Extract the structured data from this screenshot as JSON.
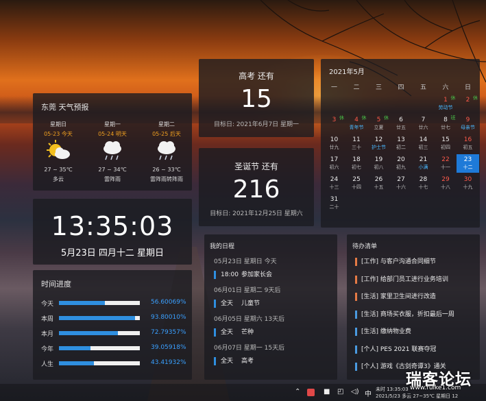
{
  "weather": {
    "title": "东莞 天气预报",
    "days": [
      {
        "name": "星期日",
        "date": "05-23 今天",
        "icon": "partly-cloudy-icon",
        "temp": "27 ~ 35℃",
        "desc": "多云"
      },
      {
        "name": "星期一",
        "date": "05-24 明天",
        "icon": "thunder-rain-icon",
        "temp": "27 ~ 34℃",
        "desc": "雷阵雨"
      },
      {
        "name": "星期二",
        "date": "05-25 后天",
        "icon": "thunder-rain-icon",
        "temp": "26 ~ 33℃",
        "desc": "雷阵雨转阵雨"
      }
    ]
  },
  "clock": {
    "time": "13:35:03",
    "date": "5月23日 四月十二 星期日"
  },
  "progress": {
    "title": "时间进度",
    "rows": [
      {
        "label": "今天",
        "value": "56.60069%",
        "fraction": 0.566
      },
      {
        "label": "本周",
        "value": "93.80010%",
        "fraction": 0.938
      },
      {
        "label": "本月",
        "value": "72.79357%",
        "fraction": 0.728
      },
      {
        "label": "今年",
        "value": "39.05918%",
        "fraction": 0.391
      },
      {
        "label": "人生",
        "value": "43.41932%",
        "fraction": 0.434
      }
    ]
  },
  "countdowns": [
    {
      "label": "高考 还有",
      "days": "15",
      "target": "目标日: 2021年6月7日 星期一"
    },
    {
      "label": "圣诞节 还有",
      "days": "216",
      "target": "目标日: 2021年12月25日 星期六"
    }
  ],
  "calendar": {
    "title": "2021年5月",
    "weekdays": [
      "一",
      "二",
      "三",
      "四",
      "五",
      "六",
      "日"
    ],
    "weeks": [
      [
        null,
        null,
        null,
        null,
        null,
        {
          "n": "1",
          "l": "劳动节",
          "red": true,
          "fest": true,
          "badge": "休"
        },
        {
          "n": "2",
          "l": "",
          "red": true,
          "badge": "休"
        }
      ],
      [
        {
          "n": "3",
          "l": "",
          "red": true,
          "badge": "休"
        },
        {
          "n": "4",
          "l": "青年节",
          "red": true,
          "fest": true,
          "badge": "休"
        },
        {
          "n": "5",
          "l": "立夏",
          "red": true,
          "badge": "休"
        },
        {
          "n": "6",
          "l": "廿五"
        },
        {
          "n": "7",
          "l": "廿六"
        },
        {
          "n": "8",
          "l": "廿七",
          "badge": "班"
        },
        {
          "n": "9",
          "l": "母亲节",
          "red": true,
          "fest": true
        }
      ],
      [
        {
          "n": "10",
          "l": "廿九"
        },
        {
          "n": "11",
          "l": "三十"
        },
        {
          "n": "12",
          "l": "护士节",
          "fest": true
        },
        {
          "n": "13",
          "l": "初二"
        },
        {
          "n": "14",
          "l": "初三"
        },
        {
          "n": "15",
          "l": "初四"
        },
        {
          "n": "16",
          "l": "初五",
          "red": true
        }
      ],
      [
        {
          "n": "17",
          "l": "初六"
        },
        {
          "n": "18",
          "l": "初七"
        },
        {
          "n": "19",
          "l": "初八"
        },
        {
          "n": "20",
          "l": "初九"
        },
        {
          "n": "21",
          "l": "小满",
          "blue": true
        },
        {
          "n": "22",
          "l": "十一",
          "red": true
        },
        {
          "n": "23",
          "l": "十二",
          "today": true
        }
      ],
      [
        {
          "n": "24",
          "l": "十三"
        },
        {
          "n": "25",
          "l": "十四"
        },
        {
          "n": "26",
          "l": "十五"
        },
        {
          "n": "27",
          "l": "十六"
        },
        {
          "n": "28",
          "l": "十七"
        },
        {
          "n": "29",
          "l": "十八",
          "red": true
        },
        {
          "n": "30",
          "l": "十九",
          "red": true
        }
      ],
      [
        {
          "n": "31",
          "l": "二十"
        },
        null,
        null,
        null,
        null,
        null,
        null
      ]
    ]
  },
  "schedule": {
    "title": "我的日程",
    "entries": [
      {
        "type": "date",
        "text": "05月23日 星期日 今天"
      },
      {
        "type": "item",
        "time": "18:00",
        "text": "参加家长会"
      },
      {
        "type": "date",
        "text": "06月01日 星期二 9天后"
      },
      {
        "type": "item",
        "time": "全天",
        "text": "儿童节"
      },
      {
        "type": "date",
        "text": "06月05日 星期六 13天后"
      },
      {
        "type": "item",
        "time": "全天",
        "text": "芒种"
      },
      {
        "type": "date",
        "text": "06月07日 星期一 15天后"
      },
      {
        "type": "item",
        "time": "全天",
        "text": "高考"
      }
    ]
  },
  "todo": {
    "title": "待办清单",
    "items": [
      {
        "text": "[工作] 与客户沟通合同细节",
        "color": "#e57a45"
      },
      {
        "text": "[工作] 给部门员工进行业务培训",
        "color": "#e57a45"
      },
      {
        "text": "[生活] 家里卫生间进行改造",
        "color": "#e57a45"
      },
      {
        "text": "[生活] 商场买衣服，折扣最后一周",
        "color": "#4a9ae0"
      },
      {
        "text": "[生活] 缴纳物业费",
        "color": "#4a9ae0"
      },
      {
        "text": "[个人] PES 2021 联赛夺冠",
        "color": "#4a9ae0"
      },
      {
        "text": "[个人] 游戏《古剑奇谭3》通关",
        "color": "#4a9ae0"
      }
    ]
  },
  "taskbar": {
    "ime": "中",
    "line1": "未时 13:35:03",
    "line2": "2021/5/23 多云 27~35℃ 星期日 12"
  },
  "watermark": {
    "big": "瑞客论坛",
    "small": "www.ruike1.com"
  }
}
